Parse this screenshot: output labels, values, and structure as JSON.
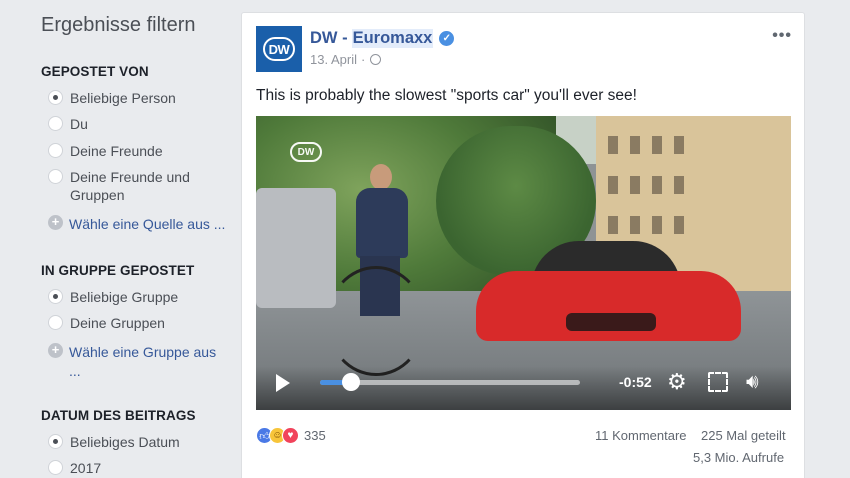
{
  "filters": {
    "title": "Ergebnisse filtern",
    "posted_by": {
      "heading": "GEPOSTET VON",
      "options": [
        {
          "label": "Beliebige Person",
          "checked": true
        },
        {
          "label": "Du",
          "checked": false
        },
        {
          "label": "Deine Freunde",
          "checked": false
        },
        {
          "label": "Deine Freunde und Gruppen",
          "checked": false
        }
      ],
      "add_link": "Wähle eine Quelle aus ..."
    },
    "posted_in_group": {
      "heading": "IN GRUPPE GEPOSTET",
      "options": [
        {
          "label": "Beliebige Gruppe",
          "checked": true
        },
        {
          "label": "Deine Gruppen",
          "checked": false
        }
      ],
      "add_link": "Wähle eine Gruppe aus ..."
    },
    "post_date": {
      "heading": "DATUM DES BEITRAGS",
      "options": [
        {
          "label": "Beliebiges Datum",
          "checked": true
        },
        {
          "label": "2017",
          "checked": false
        }
      ]
    }
  },
  "post": {
    "avatar_text": "DW",
    "page_name_prefix": "DW -",
    "page_name_highlight": "Euromaxx",
    "verified": "✓",
    "date": "13. April",
    "date_separator": "·",
    "more": "•••",
    "text": "This is probably the slowest \"sports car\" you'll ever see!",
    "video": {
      "watermark": "DW",
      "time_remaining": "-0:52",
      "progress": 0.12
    },
    "reactions": {
      "icons": [
        "like",
        "haha",
        "love"
      ],
      "count": "335"
    },
    "comments": "11 Kommentare",
    "shares": "225 Mal geteilt",
    "views": "5,3 Mio. Aufrufe"
  },
  "colors": {
    "link_blue": "#365899",
    "progress_blue": "#4a90e2",
    "brand_dw": "#1a5faa"
  }
}
